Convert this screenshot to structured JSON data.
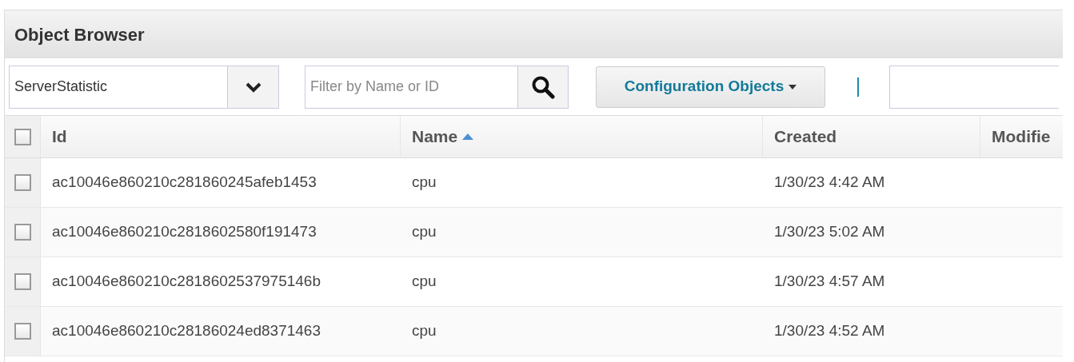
{
  "panel": {
    "title": "Object Browser"
  },
  "toolbar": {
    "type_select": {
      "value": "ServerStatistic"
    },
    "filter": {
      "placeholder": "Filter by Name or ID"
    },
    "menu_button": {
      "label": "Configuration Objects"
    }
  },
  "table": {
    "select_all": {
      "checked": false
    },
    "columns": [
      {
        "label": "Id",
        "sorted": false
      },
      {
        "label": "Name",
        "sorted": true
      },
      {
        "label": "Created",
        "sorted": false
      },
      {
        "label": "Modifie",
        "sorted": false
      }
    ],
    "rows": [
      {
        "checked": false,
        "id": "ac10046e860210c281860245afeb1453",
        "name": "cpu",
        "created": "1/30/23 4:42 AM"
      },
      {
        "checked": false,
        "id": "ac10046e860210c2818602580f191473",
        "name": "cpu",
        "created": "1/30/23 5:02 AM"
      },
      {
        "checked": false,
        "id": "ac10046e860210c2818602537975146b",
        "name": "cpu",
        "created": "1/30/23 4:57 AM"
      },
      {
        "checked": false,
        "id": "ac10046e860210c28186024ed8371463",
        "name": "cpu",
        "created": "1/30/23 4:52 AM"
      }
    ]
  }
}
